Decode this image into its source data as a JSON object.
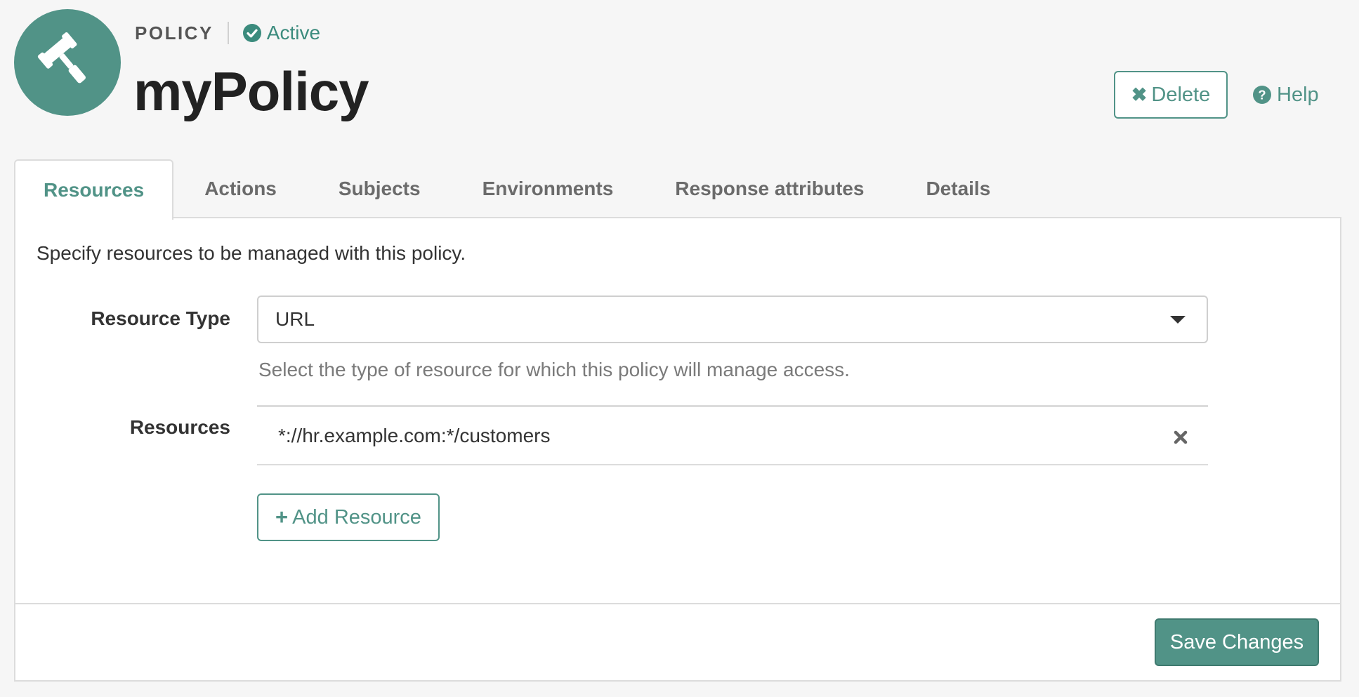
{
  "header": {
    "entity_type": "POLICY",
    "status": "Active",
    "title": "myPolicy",
    "delete_label": "Delete",
    "help_label": "Help"
  },
  "tabs": [
    {
      "label": "Resources",
      "active": true
    },
    {
      "label": "Actions",
      "active": false
    },
    {
      "label": "Subjects",
      "active": false
    },
    {
      "label": "Environments",
      "active": false
    },
    {
      "label": "Response attributes",
      "active": false
    },
    {
      "label": "Details",
      "active": false
    }
  ],
  "resources_panel": {
    "intro": "Specify resources to be managed with this policy.",
    "resource_type_label": "Resource Type",
    "resource_type_value": "URL",
    "resource_type_help": "Select the type of resource for which this policy will manage access.",
    "resources_label": "Resources",
    "resources": [
      "*://hr.example.com:*/customers"
    ],
    "add_resource_label": "Add Resource"
  },
  "footer": {
    "save_label": "Save Changes"
  },
  "colors": {
    "accent": "#519387",
    "status": "#3b8b7d",
    "background": "#f6f6f6"
  },
  "icons": {
    "header": "gavel-icon",
    "status": "check-circle-icon",
    "delete": "close-icon",
    "help": "question-circle-icon",
    "remove": "close-icon",
    "add": "plus-icon",
    "dropdown": "caret-down-icon"
  }
}
